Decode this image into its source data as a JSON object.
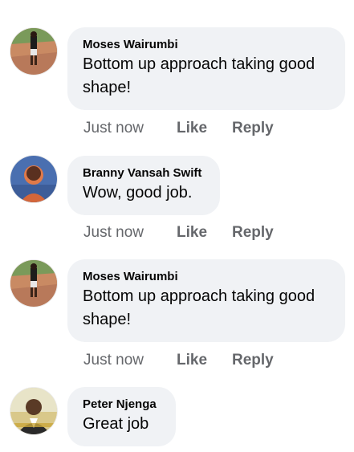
{
  "comments": [
    {
      "author": "Moses Wairumbi",
      "text": "Bottom up approach taking good shape!",
      "time": "Just now",
      "like_label": "Like",
      "reply_label": "Reply"
    },
    {
      "author": "Branny Vansah Swift",
      "text": "Wow, good job.",
      "time": "Just now",
      "like_label": "Like",
      "reply_label": "Reply"
    },
    {
      "author": "Moses Wairumbi",
      "text": "Bottom up approach taking good shape!",
      "time": "Just now",
      "like_label": "Like",
      "reply_label": "Reply"
    },
    {
      "author": "Peter Njenga",
      "text": "Great job",
      "time": "",
      "like_label": "",
      "reply_label": ""
    }
  ]
}
